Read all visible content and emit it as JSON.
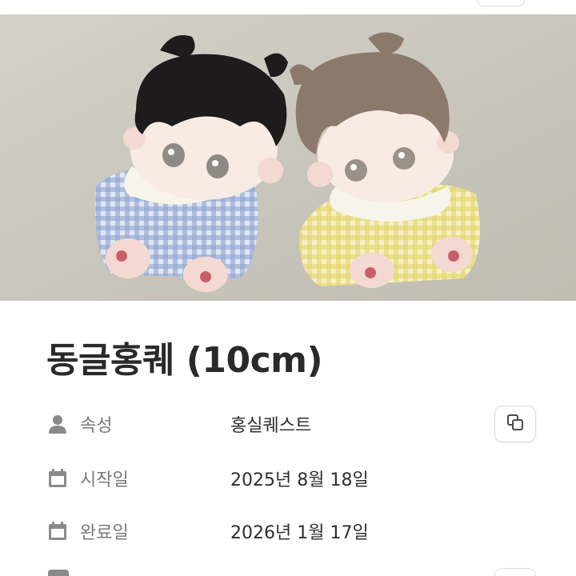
{
  "page": {
    "title": "동글홍퀘 (10cm)"
  },
  "photo": {
    "description_icon": "plush-dolls-photo"
  },
  "properties": [
    {
      "icon": "person-icon",
      "label": "속성",
      "value": "홍실퀘스트"
    },
    {
      "icon": "calendar-icon",
      "label": "시작일",
      "value": "2025년 8월 18일"
    },
    {
      "icon": "calendar-icon",
      "label": "완료일",
      "value": "2026년 1월 17일"
    }
  ],
  "actions": {
    "copy_icon": "copy-icon"
  },
  "colors": {
    "text_primary": "#2a2a2a",
    "text_secondary": "#7a7a7a",
    "icon_gray": "#8a8a8a",
    "border": "#dcdcdc"
  }
}
